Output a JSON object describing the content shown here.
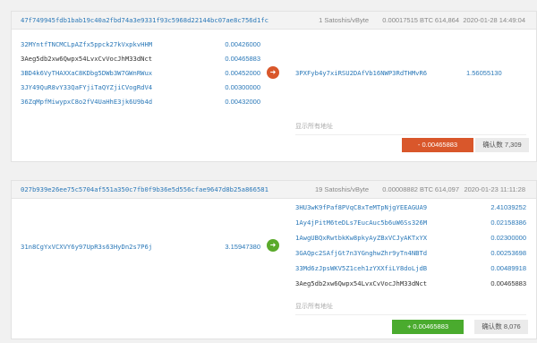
{
  "transactions": [
    {
      "txid": "47f749945fdb1bab19c40a2fbd74a3e9331f93c5968d22144bc07ae8c756d1fc",
      "fee_rate": "1 Satoshis/vByte",
      "fee": "0.00017515 BTC",
      "height": "614,864",
      "time": "2020-01-28 14:49:04",
      "inputs": [
        {
          "address": "32MYntfTNCMCLpAZfx5ppck27kVxpkvHHM",
          "amount": "0.00426000",
          "self": false
        },
        {
          "address": "3Aeg5db2xw6Qwpx54LvxCvVocJhM33dNct",
          "amount": "0.00465883",
          "self": true
        },
        {
          "address": "3BD4k6VyTHAXXaC8KDbg5DWb3W7GWnRWux",
          "amount": "0.00452000",
          "self": false
        },
        {
          "address": "3JY49QuR8vY33QaFYjiTaQYZjiCVogRdV4",
          "amount": "0.00300000",
          "self": false
        },
        {
          "address": "36ZqMpfMiwypxC8o2fV4UaHhE3jk6U9b4d",
          "amount": "0.00432000",
          "self": false
        }
      ],
      "outputs": [
        {
          "address": "3PXFyb4y7xiRSU2DAfVb16NWP3RdTHMvR6",
          "amount": "1.56055130",
          "self": false
        }
      ],
      "show_all": "显示所有地址",
      "value": "- 0.00465883",
      "confirmations": "确认数 7,309"
    },
    {
      "txid": "027b939e26ee75c5704af551a350c7fb0f9b36e5d556cfae9647d8b25a866581",
      "fee_rate": "19 Satoshis/vByte",
      "fee": "0.00008882 BTC",
      "height": "614,097",
      "time": "2020-01-23 11:11:28",
      "inputs": [
        {
          "address": "31n8CgYxVCXVY6y97UpR3s63HyDn2s7P6j",
          "amount": "3.15947380",
          "self": false
        }
      ],
      "outputs": [
        {
          "address": "3HU3wK9fPaf8PVqC8xTeMTpNjgYEEAGUA9",
          "amount": "2.41039252",
          "self": false
        },
        {
          "address": "1Ay4jPitM6teDLs7EucAuc5b6uW6Ss326M",
          "amount": "0.02158386",
          "self": false
        },
        {
          "address": "1AwgUBQxRwtbkKw8pkyAyZBxVCJyAKTxYX",
          "amount": "0.02300000",
          "self": false
        },
        {
          "address": "3GAQpc2SAfjGt7n3YGnghwZhr9yTn4NBTd",
          "amount": "0.00253698",
          "self": false
        },
        {
          "address": "33Md6zJpsWKV5Z1ceh1zYXXfiLY8doLjdB",
          "amount": "0.00489918",
          "self": false
        },
        {
          "address": "3Aeg5db2xw6Qwpx54LvxCvVocJhM33dNct",
          "amount": "0.00465883",
          "self": true
        }
      ],
      "show_all": "显示所有地址",
      "value": "+ 0.00465883",
      "confirmations": "确认数 8,076"
    }
  ],
  "colors": {
    "link": "#2a78b8",
    "negative": "#d9572b",
    "positive": "#4aab2e"
  },
  "icons": {
    "out_arrow": "arrow-right-icon",
    "in_arrow": "arrow-right-icon"
  }
}
